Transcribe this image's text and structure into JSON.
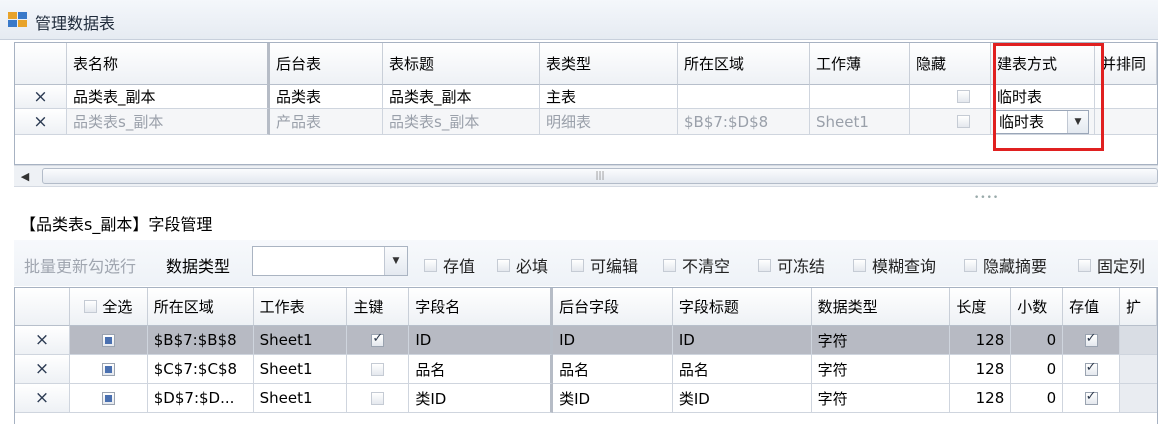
{
  "window": {
    "title": "管理数据表"
  },
  "tables_grid": {
    "columns": [
      "表名称",
      "后台表",
      "表标题",
      "表类型",
      "所在区域",
      "工作薄",
      "隐藏",
      "建表方式",
      "并排同"
    ],
    "rows": [
      {
        "delete": "×",
        "name": "品类表_副本",
        "backend": "品类表",
        "caption": "品类表_副本",
        "type": "主表",
        "area": "",
        "workbook": "",
        "hidden": false,
        "create_mode": "临时表"
      },
      {
        "delete": "×",
        "name": "品类表s_副本",
        "backend": "产品表",
        "caption": "品类表s_副本",
        "type": "明细表",
        "area": "$B$7:$D$8",
        "workbook": "Sheet1",
        "hidden": false,
        "create_mode": "临时表"
      }
    ]
  },
  "fields_panel": {
    "title": "【品类表s_副本】字段管理",
    "toolbar": {
      "batch_update": "批量更新勾选行",
      "data_type_label": "数据类型",
      "data_type_value": "",
      "checkboxes": [
        "存值",
        "必填",
        "可编辑",
        "不清空",
        "可冻结",
        "模糊查询",
        "隐藏摘要",
        "固定列"
      ]
    },
    "columns": [
      "全选",
      "所在区域",
      "工作表",
      "主键",
      "字段名",
      "后台字段",
      "字段标题",
      "数据类型",
      "长度",
      "小数",
      "存值",
      "扩"
    ],
    "rows": [
      {
        "delete": "×",
        "area": "$B$7:$B$8",
        "sheet": "Sheet1",
        "pk": true,
        "field": "ID",
        "backend_field": "ID",
        "caption": "ID",
        "dtype": "字符",
        "length": "128",
        "decimals": "0",
        "store": true
      },
      {
        "delete": "×",
        "area": "$C$7:$C$8",
        "sheet": "Sheet1",
        "pk": false,
        "field": "品名",
        "backend_field": "品名",
        "caption": "品名",
        "dtype": "字符",
        "length": "128",
        "decimals": "0",
        "store": true
      },
      {
        "delete": "×",
        "area": "$D$7:$D...",
        "sheet": "Sheet1",
        "pk": false,
        "field": "类ID",
        "backend_field": "类ID",
        "caption": "类ID",
        "dtype": "字符",
        "length": "128",
        "decimals": "0",
        "store": true
      }
    ]
  },
  "colors": {
    "highlight": "#e02020",
    "selected_row": "#b7bac3"
  }
}
